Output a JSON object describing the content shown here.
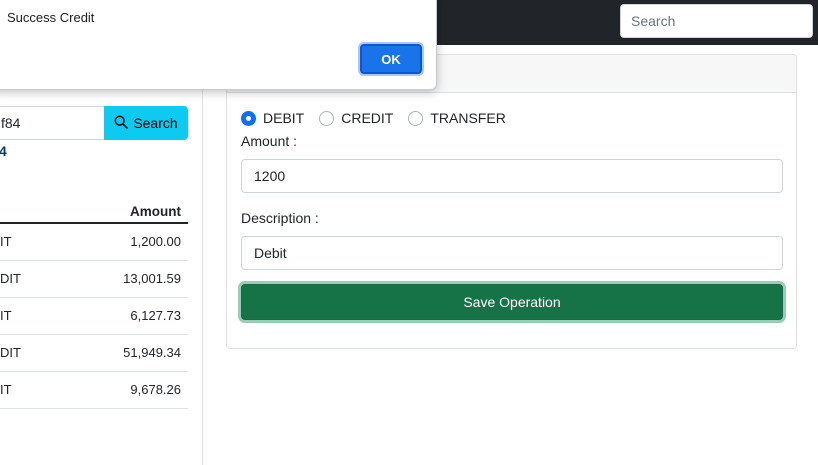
{
  "navbar": {
    "search_placeholder": "Search"
  },
  "left": {
    "account_input_value": "f84",
    "search_button_label": "Search",
    "account_digit": "4",
    "table": {
      "amount_header": "Amount",
      "rows": [
        {
          "type": "IT",
          "amount": "1,200.00"
        },
        {
          "type": "DIT",
          "amount": "13,001.59"
        },
        {
          "type": "IT",
          "amount": "6,127.73"
        },
        {
          "type": "DIT",
          "amount": "51,949.34"
        },
        {
          "type": "IT",
          "amount": "9,678.26"
        }
      ]
    }
  },
  "dialog": {
    "message": "Success Credit",
    "ok_label": "OK"
  },
  "operation": {
    "radio_debit": "DEBIT",
    "radio_credit": "CREDIT",
    "radio_transfer": "TRANSFER",
    "selected": "DEBIT",
    "amount_label": "Amount :",
    "amount_value": "1200",
    "description_label": "Description :",
    "description_value": "Debit",
    "save_label": "Save Operation"
  },
  "colors": {
    "navbar": "#212529",
    "info": "#0dcaf0",
    "success": "#157347",
    "primary": "#0d6efd",
    "dialog_button": "#1a73e8"
  }
}
